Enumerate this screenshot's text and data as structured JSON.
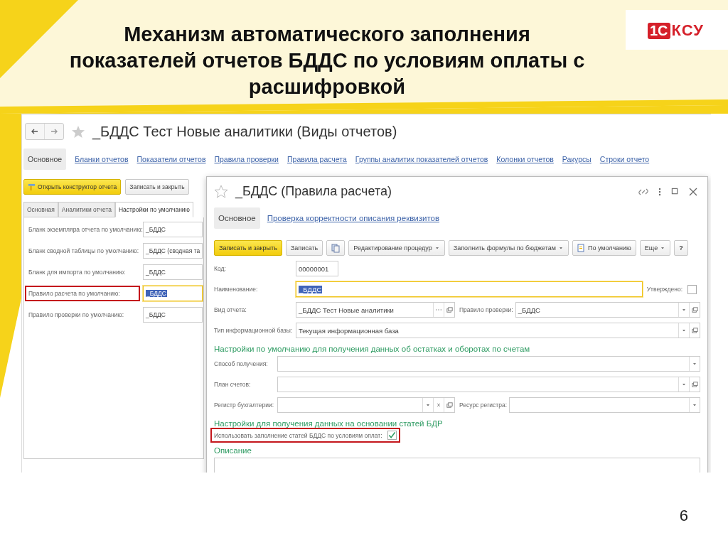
{
  "slide": {
    "title_lines": [
      "Механизм автоматического заполнения",
      "показателей отчетов БДДС по условиям оплаты с",
      "расшифровкой"
    ],
    "logo_mark": "1С",
    "logo_text": "КСУ",
    "page_number": "6"
  },
  "main_window": {
    "title": "_БДДС Тест Новые аналитики (Виды отчетов)",
    "nav": [
      {
        "label": "Основное",
        "selected": true
      },
      {
        "label": "Бланки отчетов",
        "selected": false
      },
      {
        "label": "Показатели отчетов",
        "selected": false
      },
      {
        "label": "Правила проверки",
        "selected": false
      },
      {
        "label": "Правила расчета",
        "selected": false
      },
      {
        "label": "Группы аналитик показателей отчетов",
        "selected": false
      },
      {
        "label": "Колонки отчетов",
        "selected": false
      },
      {
        "label": "Ракурсы",
        "selected": false
      },
      {
        "label": "Строки отчето",
        "selected": false
      }
    ],
    "toolbar": [
      {
        "label": "Открыть конструктор отчета",
        "kind": "primary",
        "icon": true
      },
      {
        "label": "Записать и закрыть",
        "kind": "default",
        "icon": false
      }
    ],
    "tabs": [
      {
        "label": "Основная",
        "selected": false
      },
      {
        "label": "Аналитики отчета",
        "selected": false
      },
      {
        "label": "Настройки по умолчанию",
        "selected": true
      }
    ],
    "fields": [
      {
        "label": "Бланк экземпляра отчета по умолчанию:",
        "value": "_БДДС",
        "annotated": false,
        "focused": false,
        "text_selected": false
      },
      {
        "label": "Бланк сводной таблицы по умолчанию:",
        "value": "_БДДС (сводная та",
        "annotated": false,
        "focused": false,
        "text_selected": false
      },
      {
        "label": "Бланк для импорта по умолчанию:",
        "value": "_БДДС",
        "annotated": false,
        "focused": false,
        "text_selected": false
      },
      {
        "label": "Правило расчета по умолчанию:",
        "value": "_БДДС",
        "annotated": true,
        "focused": true,
        "text_selected": true
      },
      {
        "label": "Правило проверки по умолчанию:",
        "value": "_БДДС",
        "annotated": false,
        "focused": false,
        "text_selected": false
      }
    ]
  },
  "dialog": {
    "title": "_БДДС (Правила расчета)",
    "nav": [
      {
        "label": "Основное",
        "selected": true
      },
      {
        "label": "Проверка корректности описания реквизитов",
        "selected": false
      }
    ],
    "toolbar": [
      {
        "label": "Записать и закрыть",
        "kind": "primary",
        "dropdown": false
      },
      {
        "label": "Записать",
        "kind": "default",
        "dropdown": false
      },
      {
        "kind": "copy",
        "dropdown": false
      },
      {
        "label": "Редактирование процедур",
        "kind": "default",
        "dropdown": true
      },
      {
        "label": "Заполнить формулы по бюджетам",
        "kind": "default",
        "dropdown": true
      },
      {
        "label": "По умолчанию",
        "kind": "defaults",
        "dropdown": false
      },
      {
        "label": "Еще",
        "kind": "default",
        "dropdown": true
      },
      {
        "label": "?",
        "kind": "help",
        "dropdown": false
      }
    ],
    "form": [
      {
        "rows": [
          {
            "items": [
              {
                "kind": "short-field",
                "label": "Код:",
                "value": "00000001"
              }
            ]
          },
          {
            "items": [
              {
                "kind": "field",
                "label": "Наименование:",
                "value": "_БДДС",
                "focused": true,
                "text_selected": true
              },
              {
                "kind": "checkbox",
                "label": "Утверждено:",
                "checked": false
              }
            ]
          },
          {
            "items": [
              {
                "kind": "field",
                "label": "Вид отчета:",
                "value": "_БДДС Тест Новые аналитики",
                "focused": false,
                "text_selected": false,
                "buttons": [
                  {
                    "kind": "choice"
                  },
                  {
                    "kind": "open"
                  }
                ]
              },
              {
                "kind": "field",
                "label": "Правило проверки:",
                "value": "_БДДС",
                "focused": false,
                "text_selected": false,
                "buttons": [
                  {
                    "kind": "dropdown"
                  },
                  {
                    "kind": "open"
                  }
                ]
              }
            ]
          },
          {
            "items": [
              {
                "kind": "field",
                "label": "Тип информационной базы:",
                "value": "Текущая информационная база",
                "focused": false,
                "text_selected": false,
                "buttons": [
                  {
                    "kind": "dropdown"
                  },
                  {
                    "kind": "open"
                  }
                ]
              }
            ]
          }
        ]
      },
      {
        "heading": "Настройки по умолчанию для получения данных об остатках и оборотах по счетам",
        "rows": [
          {
            "items": [
              {
                "kind": "field",
                "label": "Способ получения:",
                "focused": false,
                "buttons": [
                  {
                    "kind": "dropdown"
                  }
                ]
              }
            ]
          },
          {
            "items": [
              {
                "kind": "field",
                "label": "План счетов:",
                "focused": false,
                "buttons": [
                  {
                    "kind": "dropdown"
                  },
                  {
                    "kind": "open"
                  }
                ]
              }
            ]
          },
          {
            "items": [
              {
                "kind": "field",
                "label": "Регистр бухгалтерии:",
                "focused": false,
                "buttons": [
                  {
                    "kind": "dropdown"
                  },
                  {
                    "kind": "clear"
                  },
                  {
                    "kind": "open"
                  }
                ]
              },
              {
                "kind": "field",
                "label": "Ресурс регистра:",
                "focused": false,
                "buttons": [
                  {
                    "kind": "dropdown"
                  }
                ]
              }
            ]
          }
        ]
      },
      {
        "heading": "Настройки для получения данных на основании статей БДР",
        "rows": [
          {
            "items": [
              {
                "kind": "checkbox",
                "label": "Использовать заполнение статей БДДС по условиям оплат:",
                "checked": true,
                "annotated": true
              }
            ]
          }
        ]
      },
      {
        "heading": "Описание",
        "rows": [
          {
            "items": [
              {
                "kind": "textarea"
              }
            ]
          }
        ]
      }
    ]
  }
}
